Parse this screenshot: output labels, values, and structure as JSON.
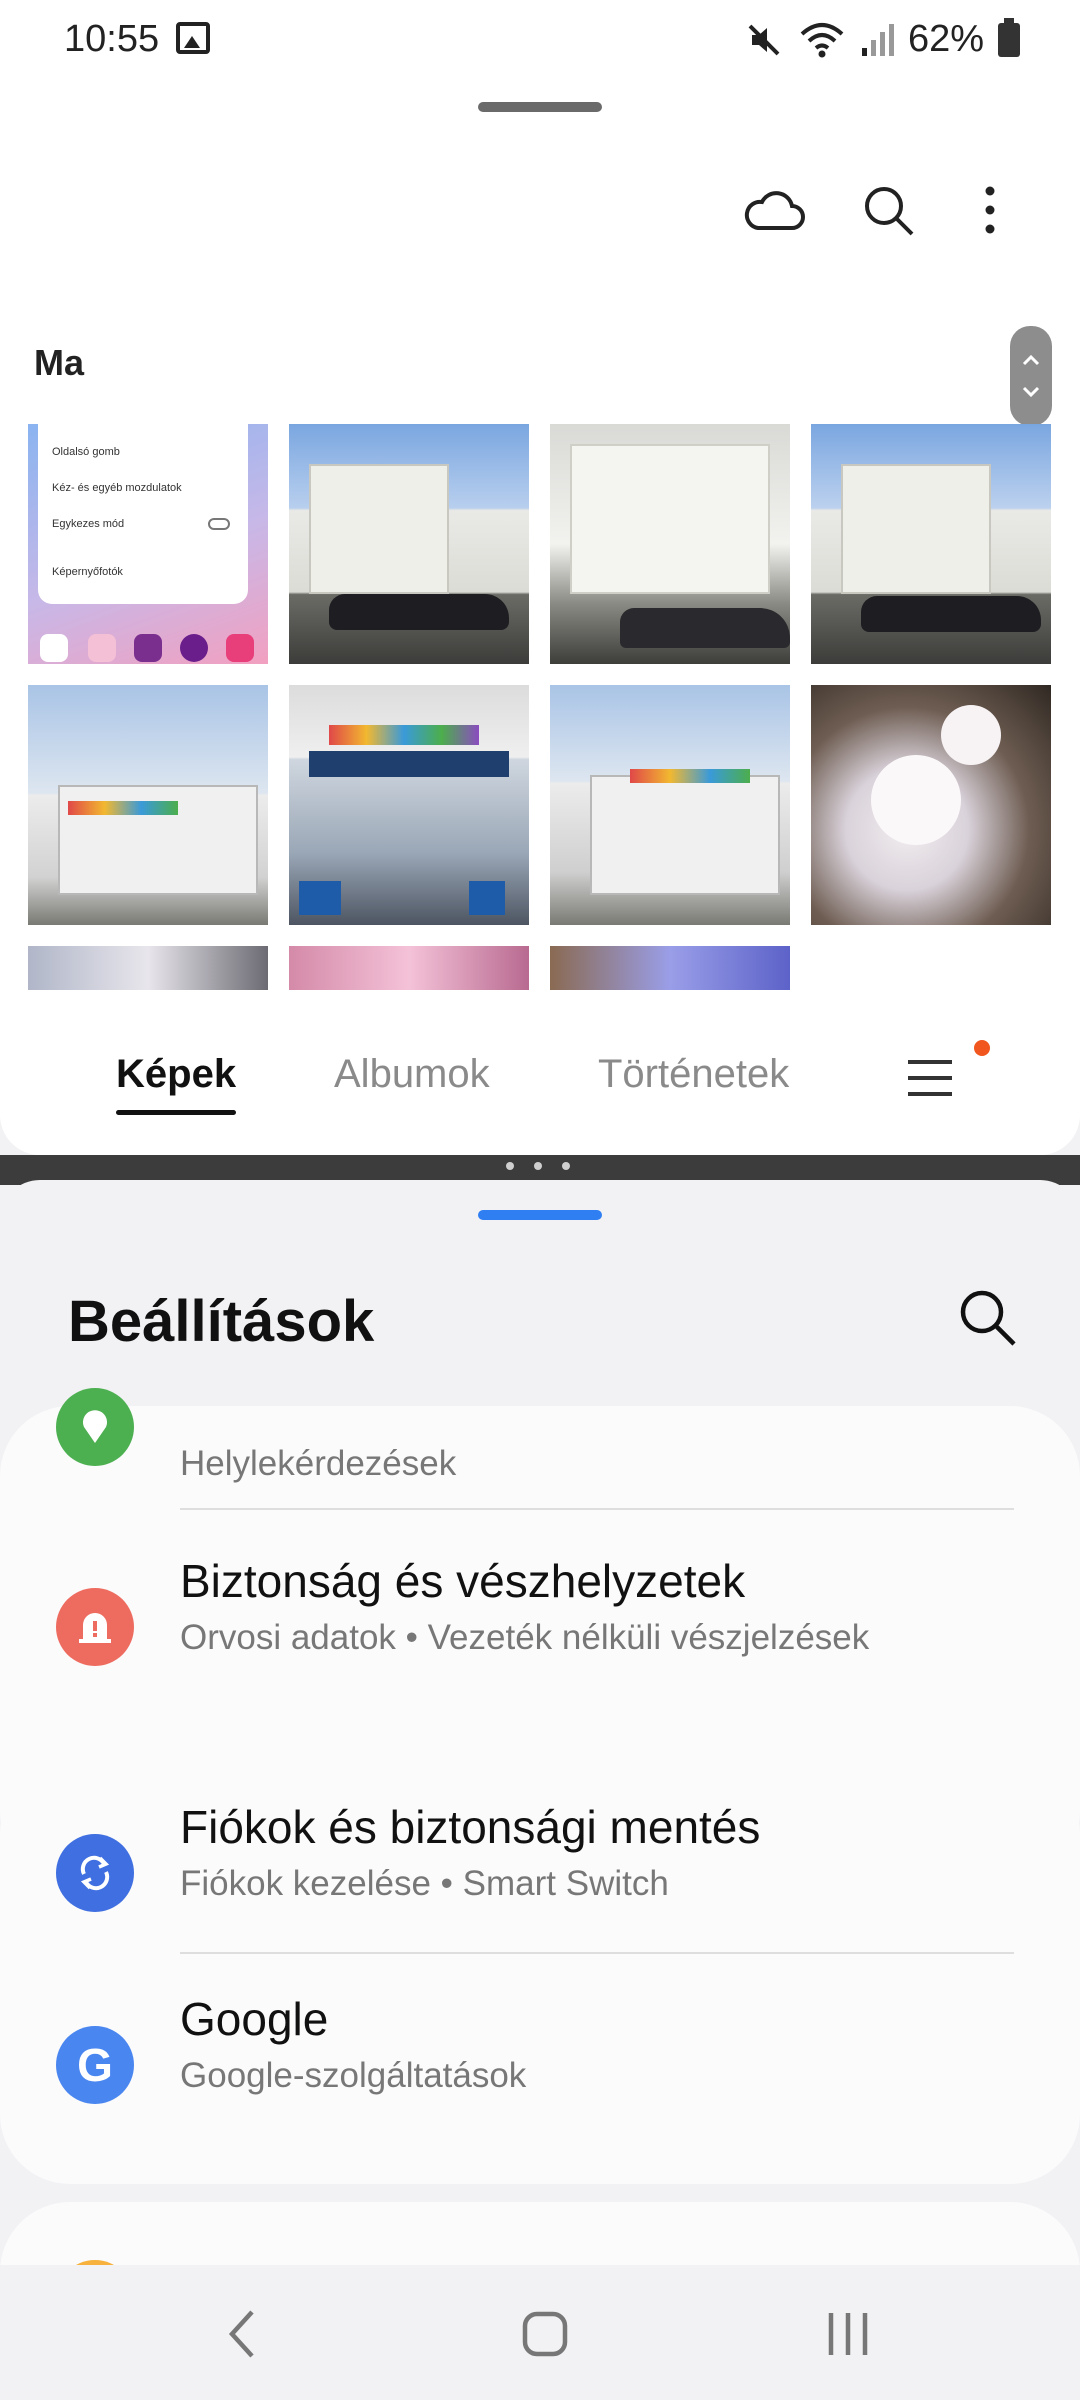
{
  "status_bar": {
    "time": "10:55",
    "battery_percent": "62%",
    "icons": [
      "gallery-notification-icon",
      "mute-icon",
      "wifi-icon",
      "signal-icon",
      "battery-icon"
    ]
  },
  "gallery": {
    "actions": [
      "cloud-icon",
      "search-icon",
      "more-options-icon"
    ],
    "section_label": "Ma",
    "thumbnails": [
      {
        "name": "screenshot-settings",
        "lines": [
          "Oldalsó gomb",
          "Kéz- és egyéb mozdulatok",
          "Egykezes mód",
          "Képernyőfotók"
        ]
      },
      {
        "name": "photo-building-car-1"
      },
      {
        "name": "photo-building-entrance"
      },
      {
        "name": "photo-building-car-2"
      },
      {
        "name": "photo-budagyongye-1"
      },
      {
        "name": "photo-budagyongye-2"
      },
      {
        "name": "photo-budagyongye-3"
      },
      {
        "name": "photo-blossom"
      },
      {
        "name": "photo-blossom-partial-1"
      },
      {
        "name": "photo-blossom-partial-2"
      },
      {
        "name": "photo-blossom-partial-3"
      }
    ],
    "tabs": [
      {
        "label": "Képek",
        "active": true
      },
      {
        "label": "Albumok",
        "active": false
      },
      {
        "label": "Történetek",
        "active": false
      }
    ],
    "menu_icon": "menu-icon",
    "notification_dot_color": "#f0561d"
  },
  "settings": {
    "title": "Beállítások",
    "items": [
      {
        "title": "",
        "subtitle": "Helylekérdezések",
        "icon": "location-icon",
        "icon_color": "#4caf50"
      },
      {
        "title": "Biztonság és vészhelyzetek",
        "subtitle": "Orvosi adatok  •  Vezeték nélküli vészjelzések",
        "icon": "safety-icon",
        "icon_color": "#ee6b5f"
      },
      {
        "title": "Fiókok és biztonsági mentés",
        "subtitle": "Fiókok kezelése  •  Smart Switch",
        "icon": "sync-icon",
        "icon_color": "#3f6fe0"
      },
      {
        "title": "Google",
        "subtitle": "Google-szolgáltatások",
        "icon": "google-icon",
        "icon_color": "#4a86f0"
      },
      {
        "title": "",
        "subtitle": "",
        "icon": "advanced-features-icon",
        "icon_color": "#f6b23c"
      }
    ]
  },
  "nav_bar": {
    "buttons": [
      "back-button",
      "home-button",
      "recents-button"
    ]
  }
}
